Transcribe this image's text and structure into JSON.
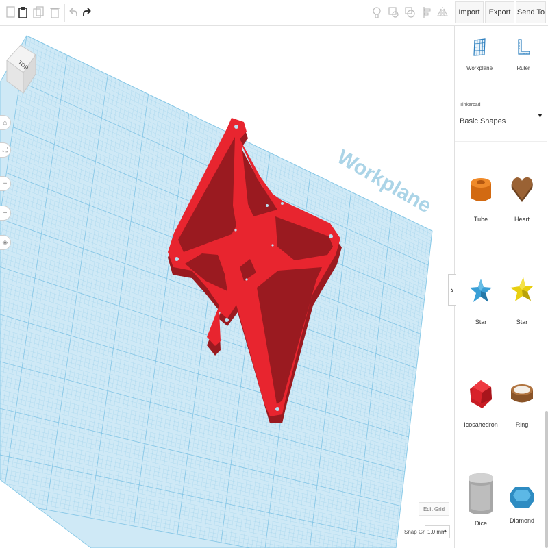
{
  "toolbar": {
    "import_label": "Import",
    "export_label": "Export",
    "sendto_label": "Send To"
  },
  "view_cube": {
    "face_label": "TOP"
  },
  "workplane": {
    "label": "Workplane"
  },
  "viewport": {
    "edit_grid_label": "Edit Grid",
    "snap_grid_label": "Snap Grid",
    "snap_grid_value": "1.0 mm"
  },
  "panel": {
    "tools": [
      {
        "label": "Workplane",
        "icon": "workplane-grid-icon"
      },
      {
        "label": "Ruler",
        "icon": "ruler-icon"
      }
    ],
    "library": {
      "provider": "Tinkercad",
      "name": "Basic Shapes"
    },
    "shapes": [
      {
        "label": "Tube",
        "icon": "tube-icon",
        "color": "#e07b1f"
      },
      {
        "label": "Heart",
        "icon": "heart-icon",
        "color": "#8b5a2b"
      },
      {
        "label": "Star",
        "icon": "star-blue-icon",
        "color": "#3a9fd6"
      },
      {
        "label": "Star",
        "icon": "star-yellow-icon",
        "color": "#e8cf10"
      },
      {
        "label": "Icosahedron",
        "icon": "icosahedron-icon",
        "color": "#d8222a"
      },
      {
        "label": "Ring",
        "icon": "ring-icon",
        "color": "#9c6235"
      },
      {
        "label": "Dice",
        "icon": "dice-icon",
        "color": "#b9b9b9"
      },
      {
        "label": "Diamond",
        "icon": "diamond-icon",
        "color": "#3fa3d8"
      }
    ]
  },
  "colors": {
    "workplane_fill": "#cfe9f6",
    "grid_line": "#7fc3e4",
    "model_red": "#e8252f",
    "model_shadow": "#9a1a20"
  }
}
